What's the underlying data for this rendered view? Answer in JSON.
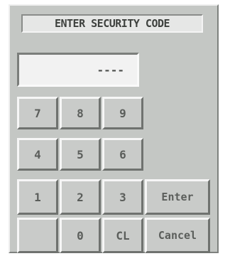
{
  "dialog": {
    "title": "ENTER SECURITY CODE",
    "display_value": "----"
  },
  "keypad": {
    "k7": "7",
    "k8": "8",
    "k9": "9",
    "k4": "4",
    "k5": "5",
    "k6": "6",
    "k1": "1",
    "k2": "2",
    "k3": "3",
    "k0": "0",
    "clear": "CL",
    "enter": "Enter",
    "cancel": "Cancel"
  }
}
